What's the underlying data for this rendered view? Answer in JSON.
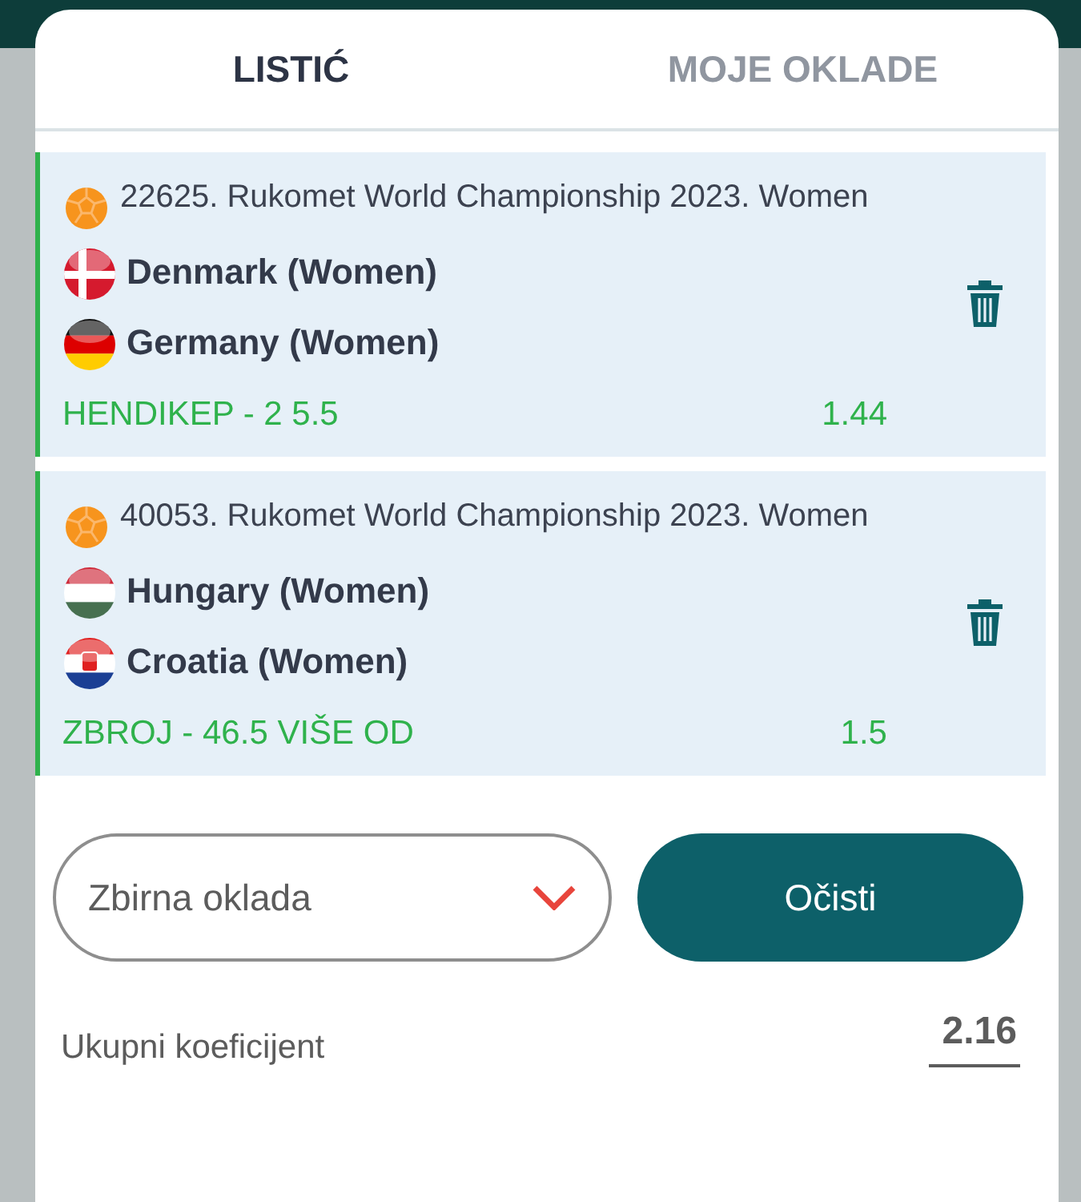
{
  "tabs": [
    {
      "label": "LISTIĆ",
      "selected": true
    },
    {
      "label": "MOJE OKLADE",
      "selected": false
    }
  ],
  "bets": [
    {
      "event": "22625. Rukomet World Championship 2023. Women",
      "teams": [
        {
          "name": "Denmark (Women)",
          "kind": "dk"
        },
        {
          "name": "Germany (Women)",
          "kind": "de"
        }
      ],
      "market": "HENDIKEP - 2 5.5",
      "odds": "1.44"
    },
    {
      "event": "40053. Rukomet World Championship 2023. Women",
      "teams": [
        {
          "name": "Hungary (Women)",
          "kind": "hu"
        },
        {
          "name": "Croatia (Women)",
          "kind": "hr"
        }
      ],
      "market": "ZBROJ - 46.5 VIŠE OD",
      "odds": "1.5"
    }
  ],
  "bet_type": {
    "value": "Zbirna oklada"
  },
  "clear_button": "Očisti",
  "total": {
    "label": "Ukupni koeficijent",
    "value": "2.16"
  }
}
